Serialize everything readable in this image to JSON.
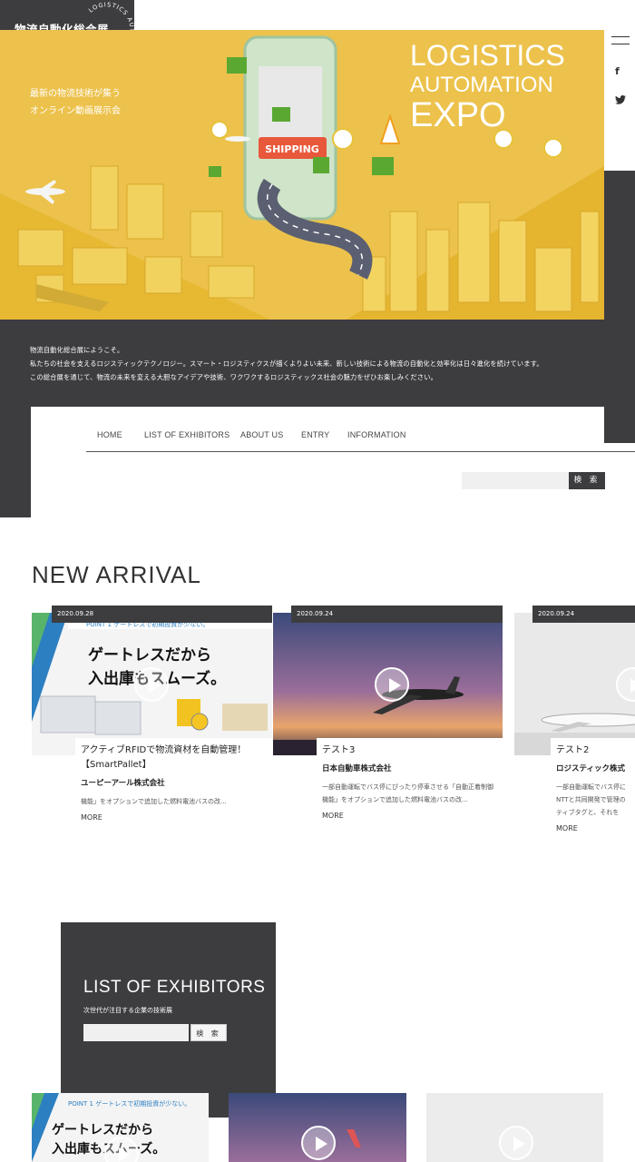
{
  "header": {
    "logo_text": "物流自動化総合展",
    "logo_ring_text": "LOGISTICS AUTOMATION EXPO",
    "hero_tagline_1": "最新の物流技術が集う",
    "hero_tagline_2": "オンライン動画展示会",
    "hero_title_1": "LOGISTICS",
    "hero_title_2": "AUTOMATION",
    "hero_title_3": "EXPO",
    "hero_sign": "SHIPPING"
  },
  "social": {
    "facebook": "f",
    "twitter": "twitter-icon"
  },
  "intro": {
    "line1": "物流自動化総合展にようこそ。",
    "line2": "私たちの社会を支えるロジスティックテクノロジー。スマート・ロジスティクスが描くよりよい未来、新しい技術による物流の自動化と効率化は日々進化を続けています。",
    "line3": "この総合展を通じて、物流の未来を変える大胆なアイデアや技術、ワクワクするロジスティックス社会の魅力をぜひお楽しみください。"
  },
  "nav": {
    "items": [
      "HOME",
      "LIST OF EXHIBITORS",
      "ABOUT US",
      "ENTRY",
      "INFORMATION"
    ]
  },
  "search": {
    "button": "検 索"
  },
  "new_arrival": {
    "title": "NEW ARRIVAL",
    "cards": [
      {
        "date": "2020.09.28",
        "thumb_banner": "POINT 1 ゲートレスで初期投資が少ない。",
        "thumb_headline_1": "ゲートレスだから",
        "thumb_headline_2": "入出庫もスムーズ。",
        "title": "アクティブRFIDで物流資材を自動管理！【SmartPallet】",
        "company": "ユーピーアール株式会社",
        "desc": "機能」をオプションで追加した燃料電池バスの改...",
        "more": "MORE"
      },
      {
        "date": "2020.09.24",
        "title": "テスト3",
        "company": "日本自動車株式会社",
        "desc": "一部自動運転でバス停にぴったり停車させる「自動正着制御機能」をオプションで追加した燃料電池バスの改...",
        "more": "MORE"
      },
      {
        "date": "2020.09.24",
        "title": "テスト2",
        "company": "ロジスティック株式",
        "desc": "一部自動運転でバス停に NTTと共同開発で管理の ティブタグと、それを",
        "more": "MORE"
      }
    ]
  },
  "exhibitors": {
    "title": "LIST OF EXHIBITORS",
    "subtitle": "次世代が注目する企業の技術展",
    "button": "検 索",
    "thumb_banner": "POINT 1 ゲートレスで初期投資が少ない。",
    "thumb_headline_1": "ゲートレスだから",
    "thumb_headline_2": "入出庫もスムーズ。"
  },
  "colors": {
    "dark": "#3d3d40",
    "hero_yellow": "#ecc24c",
    "accent_green": "#5aa832"
  }
}
